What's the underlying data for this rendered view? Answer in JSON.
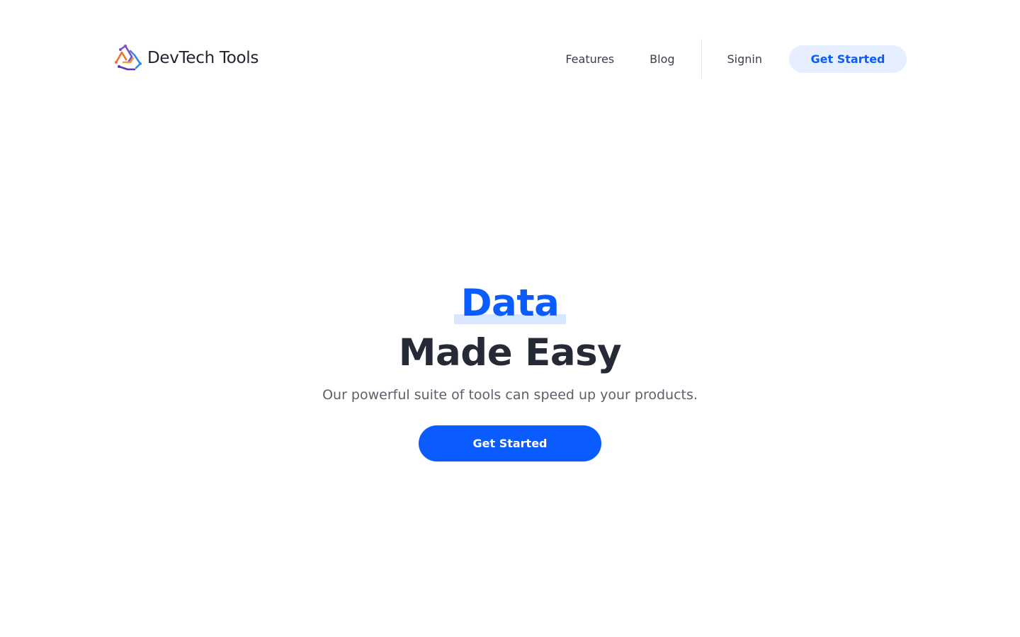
{
  "brand": {
    "name_primary": "DevTech",
    "name_secondary": "Tools",
    "logo_icon": "devtech-logo-icon"
  },
  "nav": {
    "features": "Features",
    "blog": "Blog",
    "signin": "Signin",
    "cta": "Get Started"
  },
  "hero": {
    "highlight": "Data",
    "title": "Made Easy",
    "subtitle": "Our powerful suite of tools can speed up your products.",
    "cta": "Get Started"
  },
  "colors": {
    "primary": "#0a5cff",
    "primary_soft": "#e5efff",
    "highlight_bar": "#d8e6ff",
    "heading": "#262a36",
    "body_text": "#5b606b",
    "nav_text": "#3a3f4b",
    "background": "#ffffff"
  }
}
